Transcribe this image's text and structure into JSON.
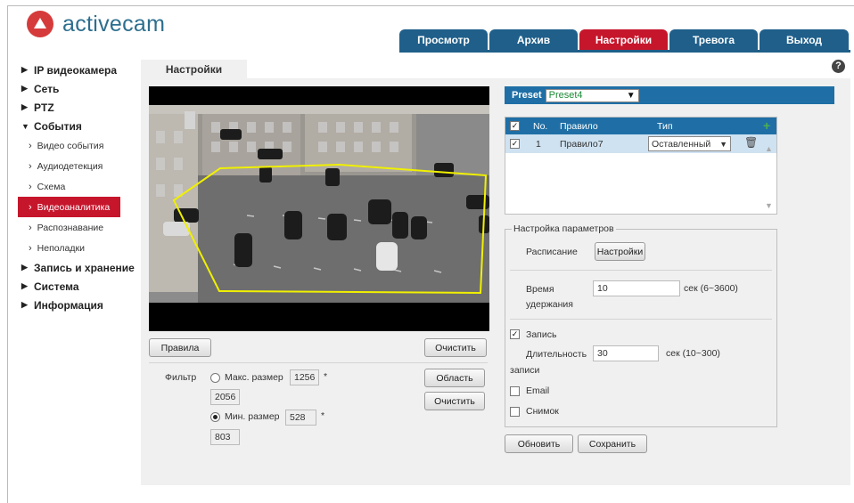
{
  "brand": {
    "name": "activecam",
    "color": "#2d6f8e",
    "mark_color": "#d63b3b"
  },
  "nav": {
    "tabs": [
      {
        "label": "Просмотр",
        "active": false
      },
      {
        "label": "Архив",
        "active": false
      },
      {
        "label": "Настройки",
        "active": true
      },
      {
        "label": "Тревога",
        "active": false
      },
      {
        "label": "Выход",
        "active": false
      }
    ],
    "color": "#1f5f8a",
    "active_color": "#c6162c"
  },
  "help_glyph": "?",
  "sidebar": {
    "items": [
      {
        "label": "IP видеокамера",
        "expanded": false
      },
      {
        "label": "Сеть",
        "expanded": false
      },
      {
        "label": "PTZ",
        "expanded": false
      },
      {
        "label": "События",
        "expanded": true
      }
    ],
    "sub": [
      {
        "label": "Видео события"
      },
      {
        "label": "Аудиодетекция"
      },
      {
        "label": "Схема"
      },
      {
        "label": "Видеоаналитика",
        "active": true
      },
      {
        "label": "Распознавание"
      },
      {
        "label": "Неполадки"
      }
    ],
    "after": [
      {
        "label": "Запись и хранение"
      },
      {
        "label": "Система"
      },
      {
        "label": "Информация"
      }
    ]
  },
  "content_tab": "Настройки",
  "left": {
    "rules_button": "Правила",
    "clear_button": "Очистить",
    "area_button": "Область",
    "clear_button2": "Очистить",
    "filter_label": "Фильтр",
    "max_size_label": "Макс. размер",
    "max_w": "1256",
    "max_h": "2056",
    "min_size_label": "Мин. размер",
    "min_w": "528",
    "min_h": "803",
    "star": "*",
    "selected_filter": "min"
  },
  "right": {
    "preset_label": "Preset",
    "preset_value": "Preset4",
    "table_headers": {
      "no": "No.",
      "rule": "Правило",
      "type": "Тип"
    },
    "rows": [
      {
        "no": "1",
        "rule": "Правило7",
        "type": "Оставленный",
        "checked": true
      }
    ],
    "params_legend": "Настройка параметров",
    "schedule_label": "Расписание",
    "schedule_button": "Настройки",
    "hold_label_1": "Время",
    "hold_label_2": "удержания",
    "hold_value": "10",
    "hold_unit": "сек (6~3600)",
    "record_label": "Запись",
    "record_checked": true,
    "duration_label_1": "Длительность",
    "duration_label_2": "записи",
    "duration_value": "30",
    "duration_unit": "сек (10~300)",
    "email_label": "Email",
    "email_checked": false,
    "snapshot_label": "Снимок",
    "snapshot_checked": false,
    "refresh_button": "Обновить",
    "save_button": "Сохранить"
  },
  "glyphs": {
    "check": "✓",
    "trash": "🗑",
    "plus": "+",
    "chevron": "⌄"
  }
}
